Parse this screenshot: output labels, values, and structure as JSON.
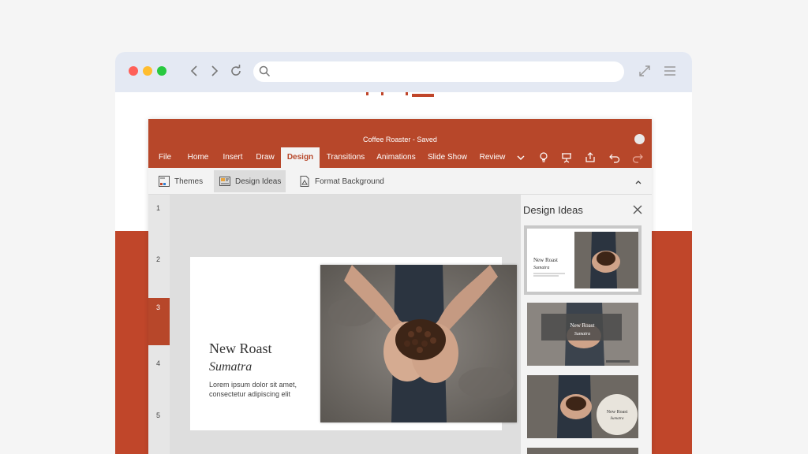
{
  "browser": {
    "url_value": "",
    "url_placeholder": ""
  },
  "app": {
    "title": "Coffee Roaster - Saved",
    "tabs": [
      {
        "label": "File"
      },
      {
        "label": "Home"
      },
      {
        "label": "Insert"
      },
      {
        "label": "Draw"
      },
      {
        "label": "Design"
      },
      {
        "label": "Transitions"
      },
      {
        "label": "Animations"
      },
      {
        "label": "Slide Show"
      },
      {
        "label": "Review"
      }
    ],
    "active_tab": "Design",
    "ribbon": {
      "themes": "Themes",
      "design_ideas": "Design Ideas",
      "format_background": "Format Background"
    },
    "slide_numbers": [
      "1",
      "2",
      "3",
      "4",
      "5"
    ],
    "active_slide": "3",
    "slide": {
      "title": "New Roast",
      "subtitle": "Sumatra",
      "body": "Lorem ipsum dolor sit amet, consectetur adipiscing elit"
    },
    "design_ideas_panel": {
      "title": "Design Ideas",
      "idea1": {
        "title": "New Roast",
        "subtitle": "Sumatra"
      },
      "idea2": {
        "title": "New Roast",
        "subtitle": "Sumatra"
      },
      "idea3": {
        "title": "New Roast",
        "subtitle": "Sumatra"
      }
    }
  },
  "colors": {
    "accent": "#b7472a",
    "browser_bar": "#e4e9f3"
  }
}
